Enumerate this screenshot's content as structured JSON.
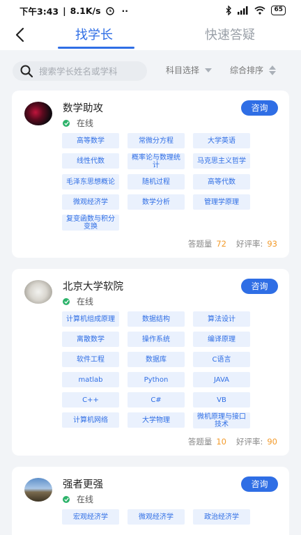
{
  "status_bar": {
    "time": "下午3:43",
    "speed": "8.1K/s",
    "battery": "65"
  },
  "nav": {
    "tab_find": "找学长",
    "tab_quick": "快速答疑"
  },
  "search": {
    "placeholder": "搜索学长姓名或学科"
  },
  "filters": {
    "subject": "科目选择",
    "sort": "综合排序"
  },
  "labels": {
    "consult": "咨询",
    "online": "在线",
    "questions": "答题量",
    "rating": "好评率:"
  },
  "colors": {
    "accent": "#2f6ee5",
    "online": "#2db36b",
    "stat_number": "#f39b2b"
  },
  "cards": [
    {
      "name": "数学助攻",
      "tags": [
        "高等数学",
        "常微分方程",
        "大学英语",
        "线性代数",
        "概率论与数理统计",
        "马克思主义哲学",
        "毛泽东思想概论",
        "随机过程",
        "高等代数",
        "微观经济学",
        "数学分析",
        "管理学原理",
        "复变函数与积分变换"
      ],
      "questions": "72",
      "rating": "93"
    },
    {
      "name": "北京大学软院",
      "tags": [
        "计算机组成原理",
        "数据结构",
        "算法设计",
        "离散数学",
        "操作系统",
        "编译原理",
        "软件工程",
        "数据库",
        "C语言",
        "matlab",
        "Python",
        "JAVA",
        "C++",
        "C#",
        "VB",
        "计算机网络",
        "大学物理",
        "微机原理与接口技术"
      ],
      "questions": "10",
      "rating": "90"
    },
    {
      "name": "强者更强",
      "tags": [
        "宏观经济学",
        "微观经济学",
        "政治经济学"
      ]
    }
  ]
}
